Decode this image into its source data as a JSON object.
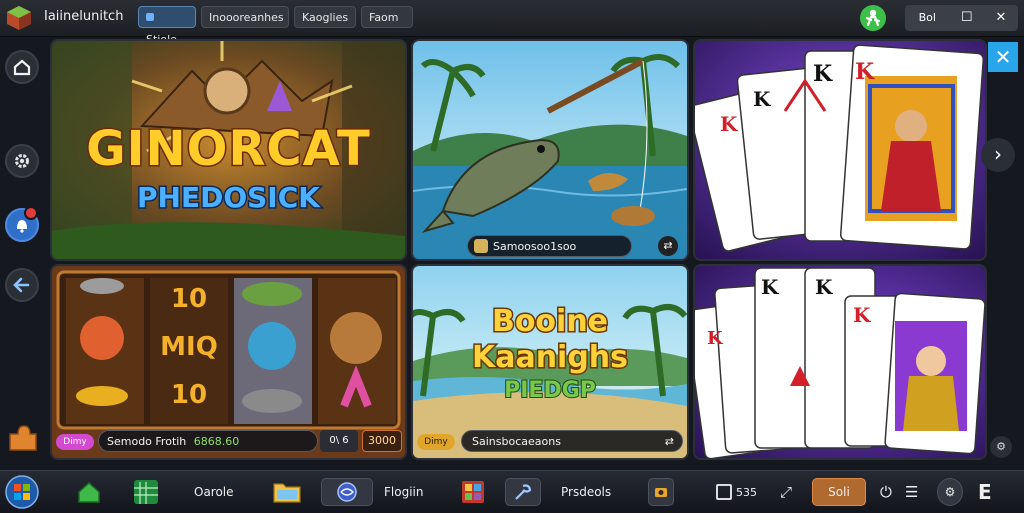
{
  "titlebar": {
    "app_title": "Iaiinelunitch",
    "tabs": [
      {
        "label": "Stiole",
        "active": true
      },
      {
        "label": "Inoooreanhes",
        "active": false
      },
      {
        "label": "Kaoglies",
        "active": false
      },
      {
        "label": "Faom",
        "active": false
      }
    ],
    "window_controls": {
      "menu_label": "Bol",
      "maximize": "☐",
      "close": "✕"
    }
  },
  "rail": {
    "items": [
      "home-icon",
      "gear-icon",
      "notification-icon",
      "back-arrow-icon"
    ]
  },
  "cards": [
    {
      "title": "GINORCAT",
      "subtitle": "PHEDOSICK"
    },
    {
      "caption": "Samoosoo1soo"
    },
    {
      "title": "playing-cards"
    },
    {
      "reels": [
        "10",
        "MIQ",
        "10"
      ],
      "chip": "Dimy",
      "caption": "Semodo Frotih",
      "value": "6868.60",
      "btn1": "0\\ 6",
      "btn2": "3000"
    },
    {
      "title": "Booine",
      "title2": "Kaanighs",
      "subtitle": "PIEDGP",
      "chip": "Dimy",
      "caption": "Sainsbocaeaons"
    },
    {
      "title": "playing-cards-2"
    }
  ],
  "overlay": {
    "close": "✕",
    "next": "›"
  },
  "taskbar": {
    "labels": [
      "Oarole",
      "Flogiin",
      "Prsdeols"
    ],
    "items": [
      "start-orb",
      "home-green-icon",
      "spreadsheet-icon",
      "folder-icon",
      "browser-icon",
      "image-app-icon",
      "tools-icon",
      "camera-icon"
    ],
    "sys_label": "535",
    "action_button": "Soli",
    "clock": "E"
  },
  "colors": {
    "accent": "#29a5ea",
    "status_green": "#3cc04a",
    "taskbar_bg": "#1b1f27"
  }
}
